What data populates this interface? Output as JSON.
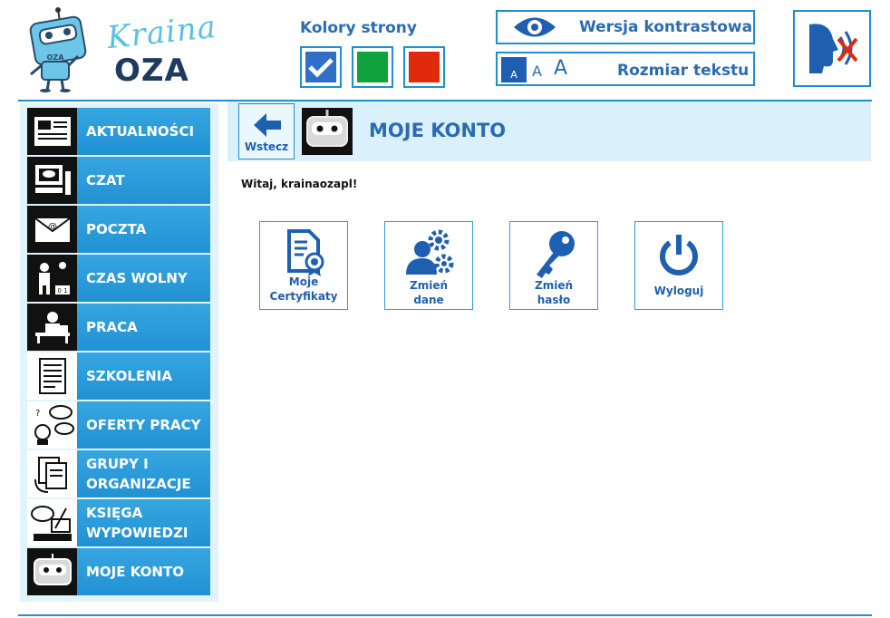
{
  "logo": {
    "word1": "Kraina",
    "word2": "OZA",
    "badge": "OZA"
  },
  "colors": {
    "title": "Kolory strony",
    "swatches": [
      {
        "name": "blue",
        "color": "#2f6fc7",
        "selected": true
      },
      {
        "name": "green",
        "color": "#10a23c",
        "selected": false
      },
      {
        "name": "red",
        "color": "#e12a0c",
        "selected": false
      }
    ]
  },
  "contrast": {
    "label": "Wersja kontrastowa",
    "icon": "eye-icon"
  },
  "textsize": {
    "label": "Rozmiar tekstu",
    "small": "A",
    "medium": "A",
    "large": "A"
  },
  "speech": {
    "icon": "speech-off-icon"
  },
  "sidebar": {
    "items": [
      {
        "label": "AKTUALNOŚCI",
        "icon": "newspaper-icon"
      },
      {
        "label": "CZAT",
        "icon": "computer-chat-icon"
      },
      {
        "label": "POCZTA",
        "icon": "envelope-icon"
      },
      {
        "label": "CZAS WOLNY",
        "icon": "leisure-icon"
      },
      {
        "label": "PRACA",
        "icon": "desk-worker-icon"
      },
      {
        "label": "SZKOLENIA",
        "icon": "document-icon"
      },
      {
        "label": "OFERTY PRACY",
        "icon": "job-offers-icon"
      },
      {
        "label": "GRUPY I ORGANIZACJE",
        "icon": "groups-icon"
      },
      {
        "label": "KSIĘGA WYPOWIEDZI",
        "icon": "guestbook-icon"
      },
      {
        "label": "MOJE KONTO",
        "icon": "robot-icon"
      }
    ]
  },
  "header": {
    "back_label": "Wstecz",
    "title": "MOJE KONTO"
  },
  "welcome": "Witaj, krainaozapl!",
  "tiles": [
    {
      "line1": "Moje",
      "line2": "Certyfikaty",
      "icon": "certificate-icon"
    },
    {
      "line1": "Zmień",
      "line2": "dane",
      "icon": "user-settings-icon"
    },
    {
      "line1": "Zmień",
      "line2": "hasło",
      "icon": "key-icon"
    },
    {
      "line1": "Wyloguj",
      "line2": "",
      "icon": "power-icon"
    }
  ],
  "accent": "#1f8fce"
}
